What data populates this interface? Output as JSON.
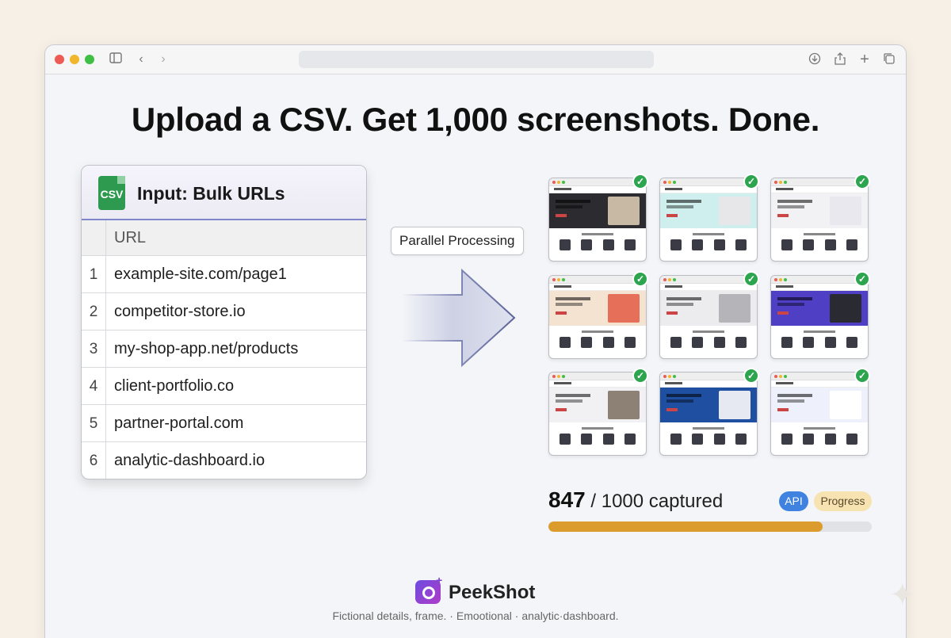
{
  "headline": "Upload a CSV. Get 1,000 screenshots. Done.",
  "input_card": {
    "icon_label": "CSV",
    "title": "Input: Bulk URLs",
    "column_header": "URL",
    "rows": [
      {
        "num": "1",
        "url": "example-site.com/page1"
      },
      {
        "num": "2",
        "url": "competitor-store.io"
      },
      {
        "num": "3",
        "url": "my-shop-app.net/products"
      },
      {
        "num": "4",
        "url": "client-portfolio.co"
      },
      {
        "num": "5",
        "url": "partner-portal.com"
      },
      {
        "num": "6",
        "url": "analytic-dashboard.io"
      }
    ]
  },
  "processing_label": "Parallel Processing",
  "thumbnails": [
    {
      "hero_color": "#2b2b30",
      "pic_color": "#c8b9a4",
      "status": "done"
    },
    {
      "hero_color": "#cfeeee",
      "pic_color": "#e7e7ea",
      "status": "done"
    },
    {
      "hero_color": "#f2f2f4",
      "pic_color": "#e8e8ee",
      "status": "done"
    },
    {
      "hero_color": "#f4e3d0",
      "pic_color": "#e66f5a",
      "status": "done"
    },
    {
      "hero_color": "#ececef",
      "pic_color": "#b5b5b9",
      "status": "done"
    },
    {
      "hero_color": "#4f3fc4",
      "pic_color": "#2a2a33",
      "status": "done"
    },
    {
      "hero_color": "#f1f1f3",
      "pic_color": "#8d8175",
      "status": "done"
    },
    {
      "hero_color": "#1f4fa0",
      "pic_color": "#e6e9f1",
      "status": "done"
    },
    {
      "hero_color": "#eef0fb",
      "pic_color": "#ffffff",
      "status": "done"
    }
  ],
  "progress": {
    "captured": "847",
    "total_text": "/ 1000 captured",
    "fraction": 0.847,
    "badge_api": "API",
    "badge_progress": "Progress"
  },
  "colors": {
    "accent_progress": "#dc9b2d",
    "check_green": "#2da44e",
    "csv_green": "#2e9a4f"
  },
  "brand": {
    "name": "PeekShot",
    "caption": "Fictional details, frame. · Emootional · analytic·dashboard."
  }
}
